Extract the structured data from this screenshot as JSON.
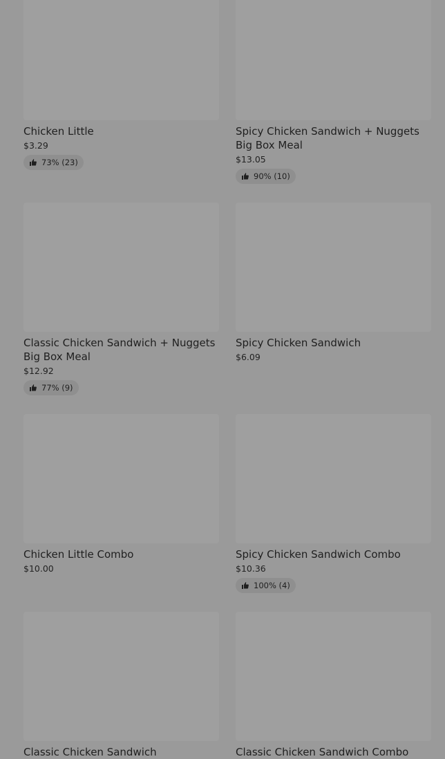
{
  "items": [
    {
      "title": "Chicken Little",
      "price": "$3.29",
      "rating": "73% (23)"
    },
    {
      "title": "Spicy Chicken Sandwich + Nuggets Big Box Meal",
      "price": "$13.05",
      "rating": "90% (10)"
    },
    {
      "title": "Classic Chicken Sandwich + Nuggets Big Box Meal",
      "price": "$12.92",
      "rating": "77% (9)"
    },
    {
      "title": "Spicy Chicken Sandwich",
      "price": "$6.09"
    },
    {
      "title": "Chicken Little Combo",
      "price": "$10.00"
    },
    {
      "title": "Spicy Chicken Sandwich Combo",
      "price": "$10.36",
      "rating": "100% (4)"
    },
    {
      "title": "Classic Chicken Sandwich"
    },
    {
      "title": "Classic Chicken Sandwich Combo"
    }
  ],
  "icons": {
    "rating": "thumbs-up-icon"
  }
}
